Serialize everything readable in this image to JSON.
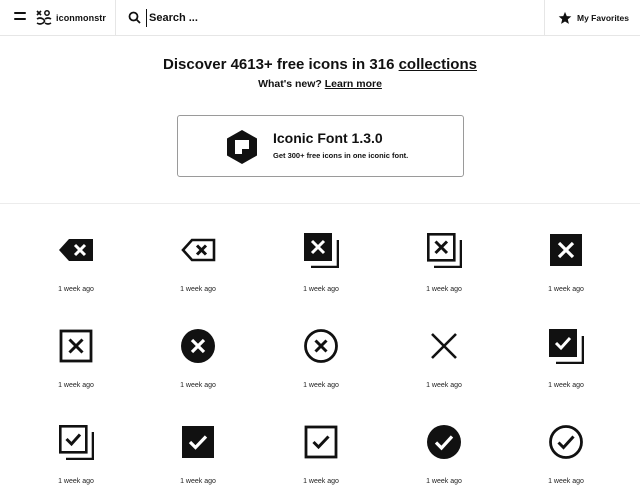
{
  "header": {
    "logo_text": "iconmonstr",
    "search_placeholder": "Search ...",
    "favorites_label": "My Favorites"
  },
  "hero": {
    "title_prefix": "Discover 4613+ free icons in 316 ",
    "title_link": "collections",
    "whats_new_prefix": "What's new? ",
    "whats_new_link": "Learn more"
  },
  "promo": {
    "title": "Iconic Font 1.3.0",
    "description": "Get 300+ free icons in one iconic font."
  },
  "icons": [
    {
      "name": "delete-filled-icon",
      "time": "1 week ago"
    },
    {
      "name": "delete-outline-icon",
      "time": "1 week ago"
    },
    {
      "name": "x-stacked-filled-icon",
      "time": "1 week ago"
    },
    {
      "name": "x-stacked-outline-icon",
      "time": "1 week ago"
    },
    {
      "name": "x-square-filled-icon",
      "time": "1 week ago"
    },
    {
      "name": "x-square-outline-icon",
      "time": "1 week ago"
    },
    {
      "name": "x-circle-filled-icon",
      "time": "1 week ago"
    },
    {
      "name": "x-circle-outline-icon",
      "time": "1 week ago"
    },
    {
      "name": "x-mark-icon",
      "time": "1 week ago"
    },
    {
      "name": "check-stacked-filled-icon",
      "time": "1 week ago"
    },
    {
      "name": "check-stacked-outline-icon",
      "time": "1 week ago"
    },
    {
      "name": "check-square-filled-icon",
      "time": "1 week ago"
    },
    {
      "name": "check-square-outline-icon",
      "time": "1 week ago"
    },
    {
      "name": "check-circle-filled-icon",
      "time": "1 week ago"
    },
    {
      "name": "check-circle-outline-icon",
      "time": "1 week ago"
    }
  ]
}
